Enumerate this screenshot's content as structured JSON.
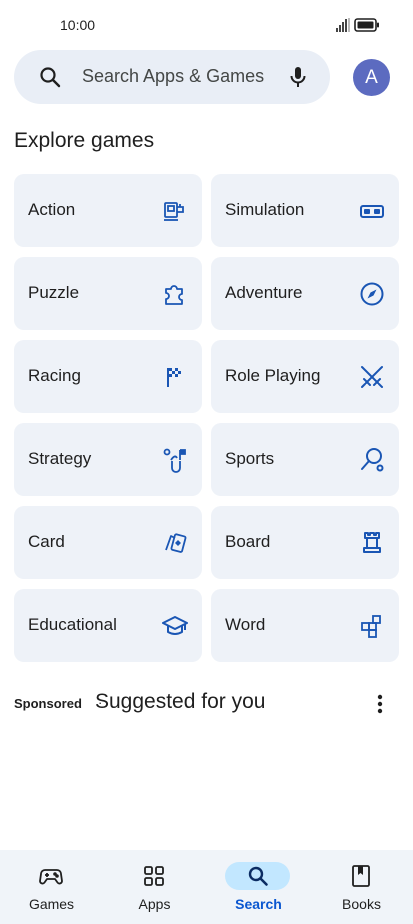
{
  "status_bar": {
    "time": "10:00"
  },
  "search": {
    "placeholder": "Search Apps & Games"
  },
  "avatar": {
    "initial": "A"
  },
  "section_title": "Explore games",
  "categories": [
    {
      "label": "Action",
      "icon": "arcade-icon"
    },
    {
      "label": "Simulation",
      "icon": "vr-headset-icon"
    },
    {
      "label": "Puzzle",
      "icon": "puzzle-piece-icon"
    },
    {
      "label": "Adventure",
      "icon": "compass-icon"
    },
    {
      "label": "Racing",
      "icon": "checkered-flag-icon"
    },
    {
      "label": "Role Playing",
      "icon": "crossed-swords-icon"
    },
    {
      "label": "Strategy",
      "icon": "strategy-icon"
    },
    {
      "label": "Sports",
      "icon": "racket-icon"
    },
    {
      "label": "Card",
      "icon": "playing-cards-icon"
    },
    {
      "label": "Board",
      "icon": "chess-rook-icon"
    },
    {
      "label": "Educational",
      "icon": "graduation-cap-icon"
    },
    {
      "label": "Word",
      "icon": "letter-tiles-icon"
    }
  ],
  "suggested": {
    "sponsored_label": "Sponsored",
    "separator": "·",
    "title": "Suggested for you"
  },
  "bottom_nav": [
    {
      "label": "Games",
      "icon": "gamepad-icon",
      "active": false
    },
    {
      "label": "Apps",
      "icon": "apps-grid-icon",
      "active": false
    },
    {
      "label": "Search",
      "icon": "search-icon",
      "active": true
    },
    {
      "label": "Books",
      "icon": "bookmark-book-icon",
      "active": false
    }
  ],
  "colors": {
    "accent": "#0b57d0",
    "icon_blue": "#1a56b4",
    "tile_bg": "#eef2f8",
    "search_bg": "#e9eef6",
    "nav_active_pill": "#c2e7ff",
    "avatar_bg": "#5c6bc0"
  }
}
